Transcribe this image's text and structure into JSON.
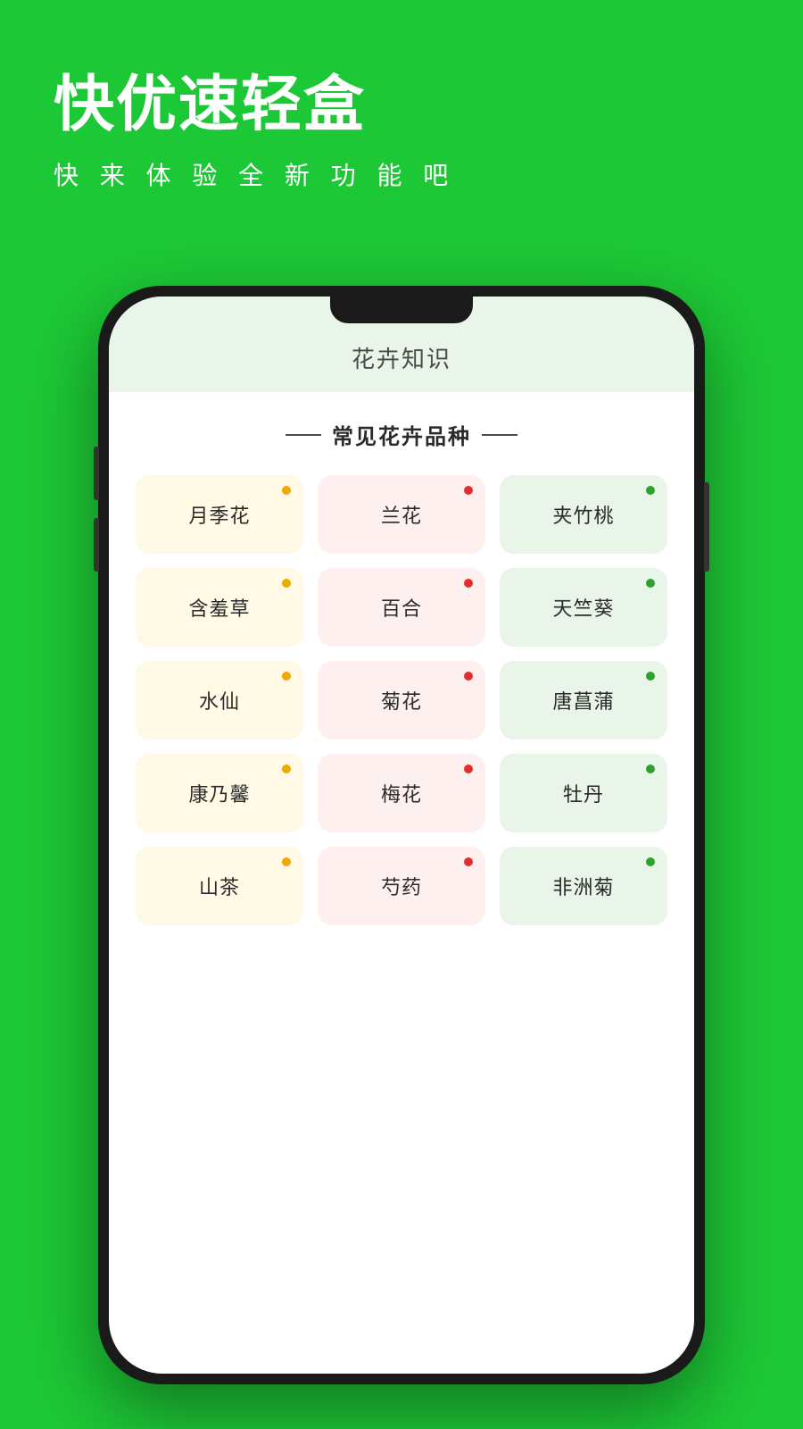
{
  "app": {
    "title": "快优速轻盒",
    "subtitle": "快 来 体 验 全 新 功 能 吧"
  },
  "screen": {
    "header_title": "花卉知识",
    "section_label": "常见花卉品种",
    "flowers": [
      {
        "name": "月季花",
        "color": "yellow",
        "dot": "yellow"
      },
      {
        "name": "兰花",
        "color": "pink",
        "dot": "red"
      },
      {
        "name": "夹竹桃",
        "color": "green",
        "dot": "green"
      },
      {
        "name": "含羞草",
        "color": "yellow",
        "dot": "yellow"
      },
      {
        "name": "百合",
        "color": "pink",
        "dot": "red"
      },
      {
        "name": "天竺葵",
        "color": "green",
        "dot": "green"
      },
      {
        "name": "水仙",
        "color": "yellow",
        "dot": "yellow"
      },
      {
        "name": "菊花",
        "color": "pink",
        "dot": "red"
      },
      {
        "name": "唐菖蒲",
        "color": "green",
        "dot": "green"
      },
      {
        "name": "康乃馨",
        "color": "yellow",
        "dot": "yellow"
      },
      {
        "name": "梅花",
        "color": "pink",
        "dot": "red"
      },
      {
        "name": "牡丹",
        "color": "green",
        "dot": "green"
      },
      {
        "name": "山茶",
        "color": "yellow",
        "dot": "yellow"
      },
      {
        "name": "芍药",
        "color": "pink",
        "dot": "red"
      },
      {
        "name": "非洲菊",
        "color": "green",
        "dot": "green"
      }
    ]
  }
}
